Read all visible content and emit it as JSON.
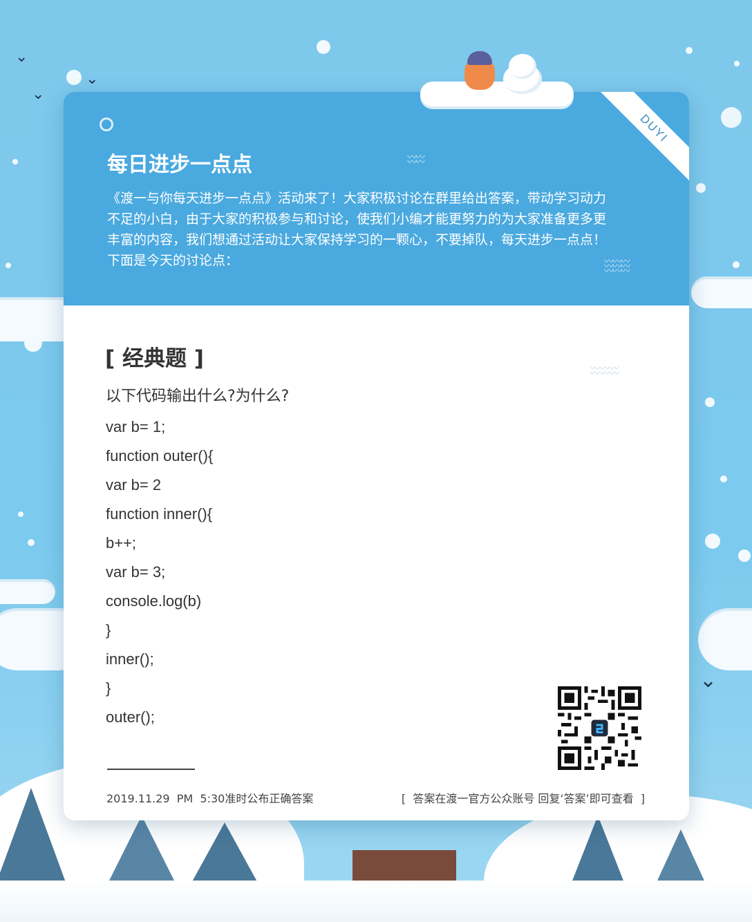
{
  "header": {
    "badge": "DUYI",
    "title": "每日进步一点点",
    "intro": "《渡一与你每天进步一点点》活动来了！大家积极讨论在群里给出答案，带动学习动力不足的小白，由于大家的积极参与和讨论，使我们小编才能更努力的为大家准备更多更丰富的内容，我们想通过活动让大家保持学习的一颗心，不要掉队，每天进步一点点！下面是今天的讨论点："
  },
  "body": {
    "section_title": "[ 经典题 ]",
    "question": "以下代码输出什么?为什么?",
    "code_lines": [
      "var b= 1;",
      "function outer(){",
      "var b= 2",
      "function inner(){",
      "b++;",
      "var b= 3;",
      "console.log(b)",
      "}",
      "inner();",
      "}",
      "outer();"
    ]
  },
  "footer": {
    "left": "2019.11.29  PM  5:30准时公布正确答案",
    "right": "[  答案在渡一官方公众账号 回复‘答案’即可查看  ]"
  },
  "icons": {
    "qr": "qr-code-icon",
    "bird": "bird-icon",
    "snowflake": "snowflake-icon"
  },
  "colors": {
    "sky": "#7ec8ec",
    "header": "#4aa9df",
    "card": "#ffffff",
    "text": "#333333"
  }
}
